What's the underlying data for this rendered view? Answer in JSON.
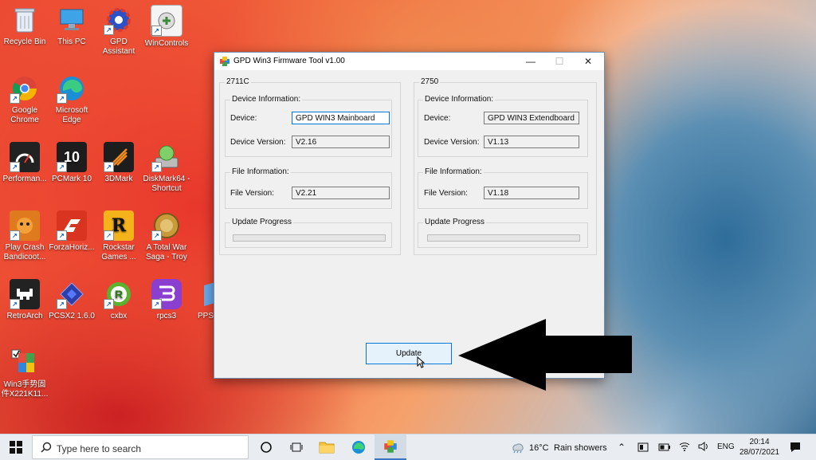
{
  "desktop": {
    "icons": [
      {
        "label": "Recycle Bin"
      },
      {
        "label": "This PC"
      },
      {
        "label": "GPD Assistant"
      },
      {
        "label": "WinControls"
      },
      {
        "label": "Google Chrome"
      },
      {
        "label": "Microsoft Edge"
      },
      {
        "label": "Performan..."
      },
      {
        "label": "PCMark 10"
      },
      {
        "label": "3DMark"
      },
      {
        "label": "DiskMark64 - Shortcut"
      },
      {
        "label": "Play Crash Bandicoot..."
      },
      {
        "label": "ForzaHoriz..."
      },
      {
        "label": "Rockstar Games ..."
      },
      {
        "label": "A Total War Saga - Troy"
      },
      {
        "label": "RetroArch"
      },
      {
        "label": "PCSX2 1.6.0"
      },
      {
        "label": "cxbx"
      },
      {
        "label": "rpcs3"
      },
      {
        "label": "PPS"
      },
      {
        "label": "Win3手势固件X221K11..."
      }
    ]
  },
  "window": {
    "title": "GPD Win3 Firmware Tool v1.00",
    "minimize": "—",
    "maximize": "☐",
    "close": "✕",
    "left_panel": {
      "title": "2711C",
      "device_info_label": "Device Information:",
      "device_label": "Device:",
      "device_value": "GPD WIN3 Mainboard",
      "device_version_label": "Device Version:",
      "device_version_value": "V2.16",
      "file_info_label": "File Information:",
      "file_version_label": "File Version:",
      "file_version_value": "V2.21",
      "update_progress_label": "Update Progress",
      "progress": 0
    },
    "right_panel": {
      "title": "2750",
      "device_info_label": "Device Information:",
      "device_label": "Device:",
      "device_value": "GPD WIN3 Extendboard",
      "device_version_label": "Device Version:",
      "device_version_value": "V1.13",
      "file_info_label": "File Information:",
      "file_version_label": "File Version:",
      "file_version_value": "V1.18",
      "update_progress_label": "Update Progress",
      "progress": 0
    },
    "update_button": "Update"
  },
  "taskbar": {
    "search_placeholder": "Type here to search",
    "weather_temp": "16°C",
    "weather_text": "Rain showers",
    "language": "ENG",
    "time": "20:14",
    "date": "28/07/2021"
  },
  "colors": {
    "accent": "#0078d7",
    "window_bg": "#f0f0f0",
    "taskbar_bg": "#e9edf2"
  }
}
